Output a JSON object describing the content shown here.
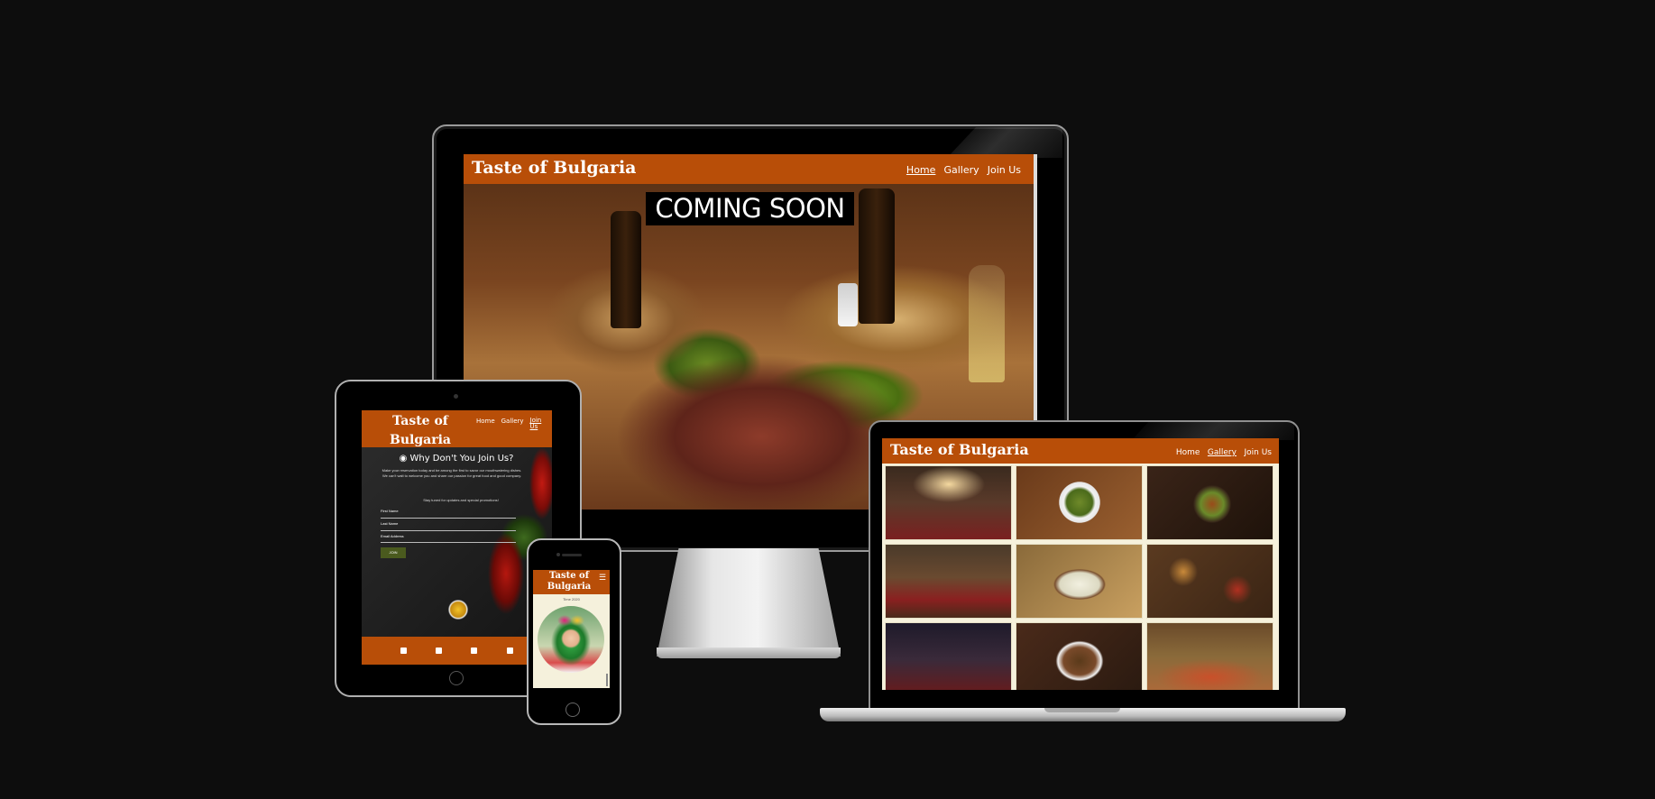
{
  "site": {
    "brand": "Taste of Bulgaria",
    "accent_color": "#b84e08",
    "cream_color": "#f6f1dc"
  },
  "monitor": {
    "nav": [
      "Home",
      "Gallery",
      "Join Us"
    ],
    "active_nav": "Home",
    "hero_text": "COMING SOON"
  },
  "tablet": {
    "brand_line1": "Taste of",
    "brand_line2": "Bulgaria",
    "nav": [
      "Home",
      "Gallery",
      "Join Us"
    ],
    "heading": "Why Don't You Join Us?",
    "intro": "Make your reservation today and be among the first to savor our mouthwatering dishes. We can't wait to welcome you and share our passion for great food and good company.",
    "stay_tuned": "Stay tuned for updates and special promotions!",
    "fields": [
      "First Name",
      "Last Name",
      "Email Address"
    ],
    "submit_label": "JOIN",
    "social_icons": [
      "facebook-icon",
      "instagram-icon",
      "twitter-icon",
      "youtube-icon"
    ]
  },
  "phone": {
    "brand_line1": "Taste of",
    "brand_line2": "Bulgaria",
    "menu_icon": "☰",
    "time_text": "Time 2020"
  },
  "laptop": {
    "nav": [
      "Home",
      "Gallery",
      "Join Us"
    ],
    "active_nav": "Gallery",
    "gallery_tiles": [
      "restaurant-interior-photo",
      "salad-plate-photo",
      "stew-bowl-photo",
      "folk-dining-room-photo",
      "yogurt-soup-photo",
      "appetizer-platter-photo",
      "cellar-room-photo",
      "stuffed-peppers-photo",
      "wine-barrels-feast-photo"
    ]
  }
}
